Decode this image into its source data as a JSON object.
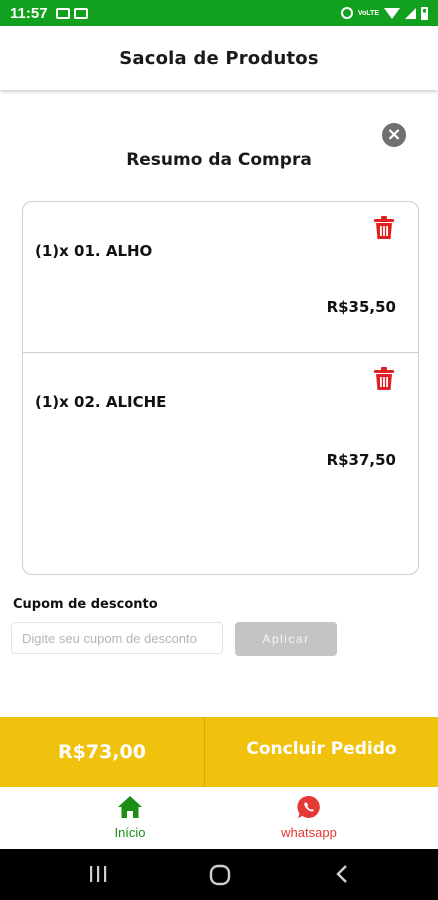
{
  "status_bar": {
    "time": "11:57",
    "left_icons": [
      "image-icon",
      "fb-notification-icon"
    ],
    "right_icons": [
      "alarm-icon",
      "volte-icon",
      "wifi-icon",
      "signal-icon",
      "battery-icon"
    ],
    "lte_text": "VoLTE",
    "color": "#12a11e"
  },
  "header": {
    "title": "Sacola de Produtos"
  },
  "summary": {
    "title": "Resumo da Compra",
    "close_icon": "close-circle-icon"
  },
  "cart": {
    "items": [
      {
        "name": "(1)x 01. ALHO",
        "price": "R$35,50"
      },
      {
        "name": "(1)x 02. ALICHE",
        "price": "R$37,50"
      }
    ],
    "delete_icon_color": "#e02020"
  },
  "coupon": {
    "label": "Cupom de desconto",
    "placeholder": "Digite seu cupom de desconto",
    "value": "",
    "apply_label": "Aplicar"
  },
  "order": {
    "total": "R$73,00",
    "finish_label": "Concluir Pedido",
    "color": "#f0c20e"
  },
  "bottom_nav": {
    "items": [
      {
        "label": "Início",
        "icon": "home-icon",
        "color": "#1a8f14"
      },
      {
        "label": "whatsapp",
        "icon": "whatsapp-icon",
        "color": "#e53935"
      }
    ]
  },
  "system_nav": {
    "buttons": [
      "recents-icon",
      "home-circle-icon",
      "back-icon"
    ]
  }
}
